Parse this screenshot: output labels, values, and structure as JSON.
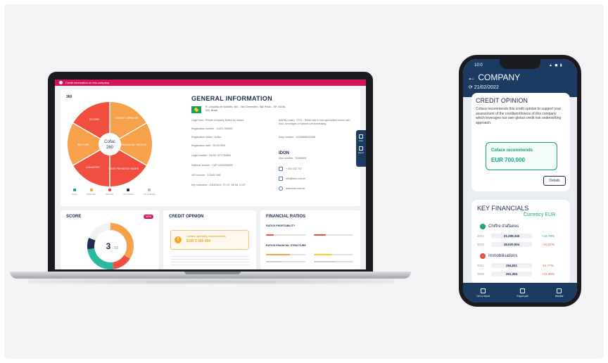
{
  "laptop": {
    "topbar_title": "Credit Information on this company",
    "score_label": "360",
    "wheel": {
      "center_line1": "Cofac",
      "center_line2": "260",
      "segments": [
        "SCORE",
        "CREDIT OPINION",
        "FINANCIAL RATIOS",
        "LATE PAYMENT INDEX",
        "COUNTRY",
        "SECTOR"
      ]
    },
    "legend": [
      "Good",
      "Moderate",
      "Warning",
      "Very Weak",
      "Not available"
    ],
    "general_info": {
      "title": "GENERAL INFORMATION",
      "address": "R. Leopoldo de Bulhões, 463 - Vila Clementino, São Paulo - SP, 04108-000, Brazil",
      "fields": [
        "Legal form : Private company limited by shares",
        "Registration number : 11421-789825",
        "Registration status : Active",
        "Registration date : 20/10/1999",
        "Legal number : 04193 1571784899",
        "National number : CAP 10225/84899",
        "VAT number : 123457 896",
        "Key indicators : 2018 8103, 70, 87, 4B 98, 4 107"
      ],
      "activity": "Activity (main) : 4721 - Retail sale in non-specialised stores with food, beverages or tobacco predominating",
      "easy_number": "Easy number : 12345608123456",
      "idon_label": "IDON",
      "idon_number": "Idon number : 70468605",
      "phone": "+ 001 242 737",
      "email": "info@idon.com.br",
      "website": "www.idon.com.br"
    },
    "side_tab": {
      "label1": "Order",
      "label2": "Report"
    },
    "score_card": {
      "title": "SCORE",
      "badge": "NEW",
      "value": "3",
      "max": "/10"
    },
    "credit_card": {
      "title": "CREDIT OPINION",
      "box_line1": "Coface partially recommends",
      "box_line2": "EUR 3 000 000"
    },
    "ratios_card": {
      "title": "FINANCIAL RATIOS",
      "sub1": "RATIOS PROFITABILITY",
      "sub2": "RATIOS FINANCIAL STRUCTURE"
    }
  },
  "phone": {
    "time": "10:0",
    "status_icons": "▲ ◼ ▮",
    "header_title": "← COMPANY",
    "header_date": "⟳ 21/02/2022",
    "credit": {
      "title": "CREDIT OPINION",
      "text": "Coface recommends this credit opinion to support your assessment of the creditworthiness of this company which leverages our own global credit risk underwriting approach.",
      "rec_line1": "Coface recommends",
      "rec_line2": "EUR 700,000",
      "details_button": "Details"
    },
    "financials": {
      "title": "KEY FINANCIALS",
      "currency": "Currency EUR",
      "sections": [
        {
          "name": "Chiffre d'affaires",
          "icon": "↑",
          "rows": [
            {
              "year": "2021",
              "value": "21,289,345",
              "pct": "+16.79%",
              "up": true
            },
            {
              "year": "2020",
              "value": "18,020,504",
              "pct": "+10.37%",
              "up": false
            }
          ]
        },
        {
          "name": "Immobilisations",
          "icon": "↓",
          "rows": [
            {
              "year": "2021",
              "value": "294,811",
              "pct": "-12.77%",
              "up": false
            },
            {
              "year": "2020",
              "value": "261,394",
              "pct": "+22.30%",
              "up": false
            }
          ]
        }
      ]
    },
    "footer": [
      "Get a report",
      "Export pdf",
      "Monitor"
    ]
  },
  "colors": {
    "brand_navy": "#1c3b63",
    "accent_pink": "#d4145a",
    "wheel_red": "#f04e3e",
    "wheel_orange": "#f7a24b",
    "success_green": "#18a085",
    "negative_red": "#e74c3c"
  }
}
